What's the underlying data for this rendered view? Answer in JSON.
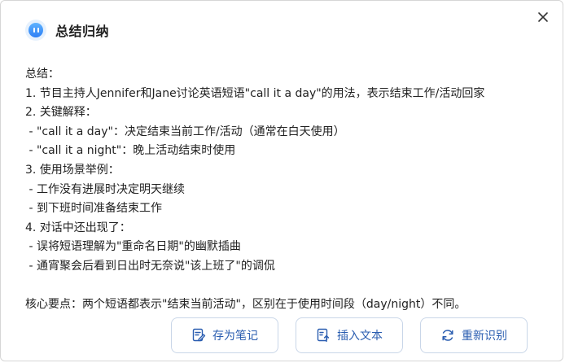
{
  "header": {
    "title": "总结归纳"
  },
  "content": {
    "lines": [
      "总结：",
      "1. 节目主持人Jennifer和Jane讨论英语短语\"call it a day\"的用法，表示结束工作/活动回家",
      "2. 关键解释：",
      " - \"call it a day\"：决定结束当前工作/活动（通常在白天使用）",
      " - \"call it a night\"：晚上活动结束时使用",
      "3. 使用场景举例：",
      " - 工作没有进展时决定明天继续",
      " - 到下班时间准备结束工作",
      "4. 对话中还出现了：",
      " - 误将短语理解为\"重命名日期\"的幽默插曲",
      " - 通宵聚会后看到日出时无奈说\"该上班了\"的调侃",
      "",
      "核心要点：两个短语都表示\"结束当前活动\"，区别在于使用时间段（day/night）不同。"
    ]
  },
  "buttons": {
    "save_note": "存为笔记",
    "insert_text": "插入文本",
    "re_recognize": "重新识别"
  },
  "colors": {
    "accent": "#2a5db0",
    "button_border": "#c9d6e8",
    "icon_blue": "#2d7ff5"
  }
}
